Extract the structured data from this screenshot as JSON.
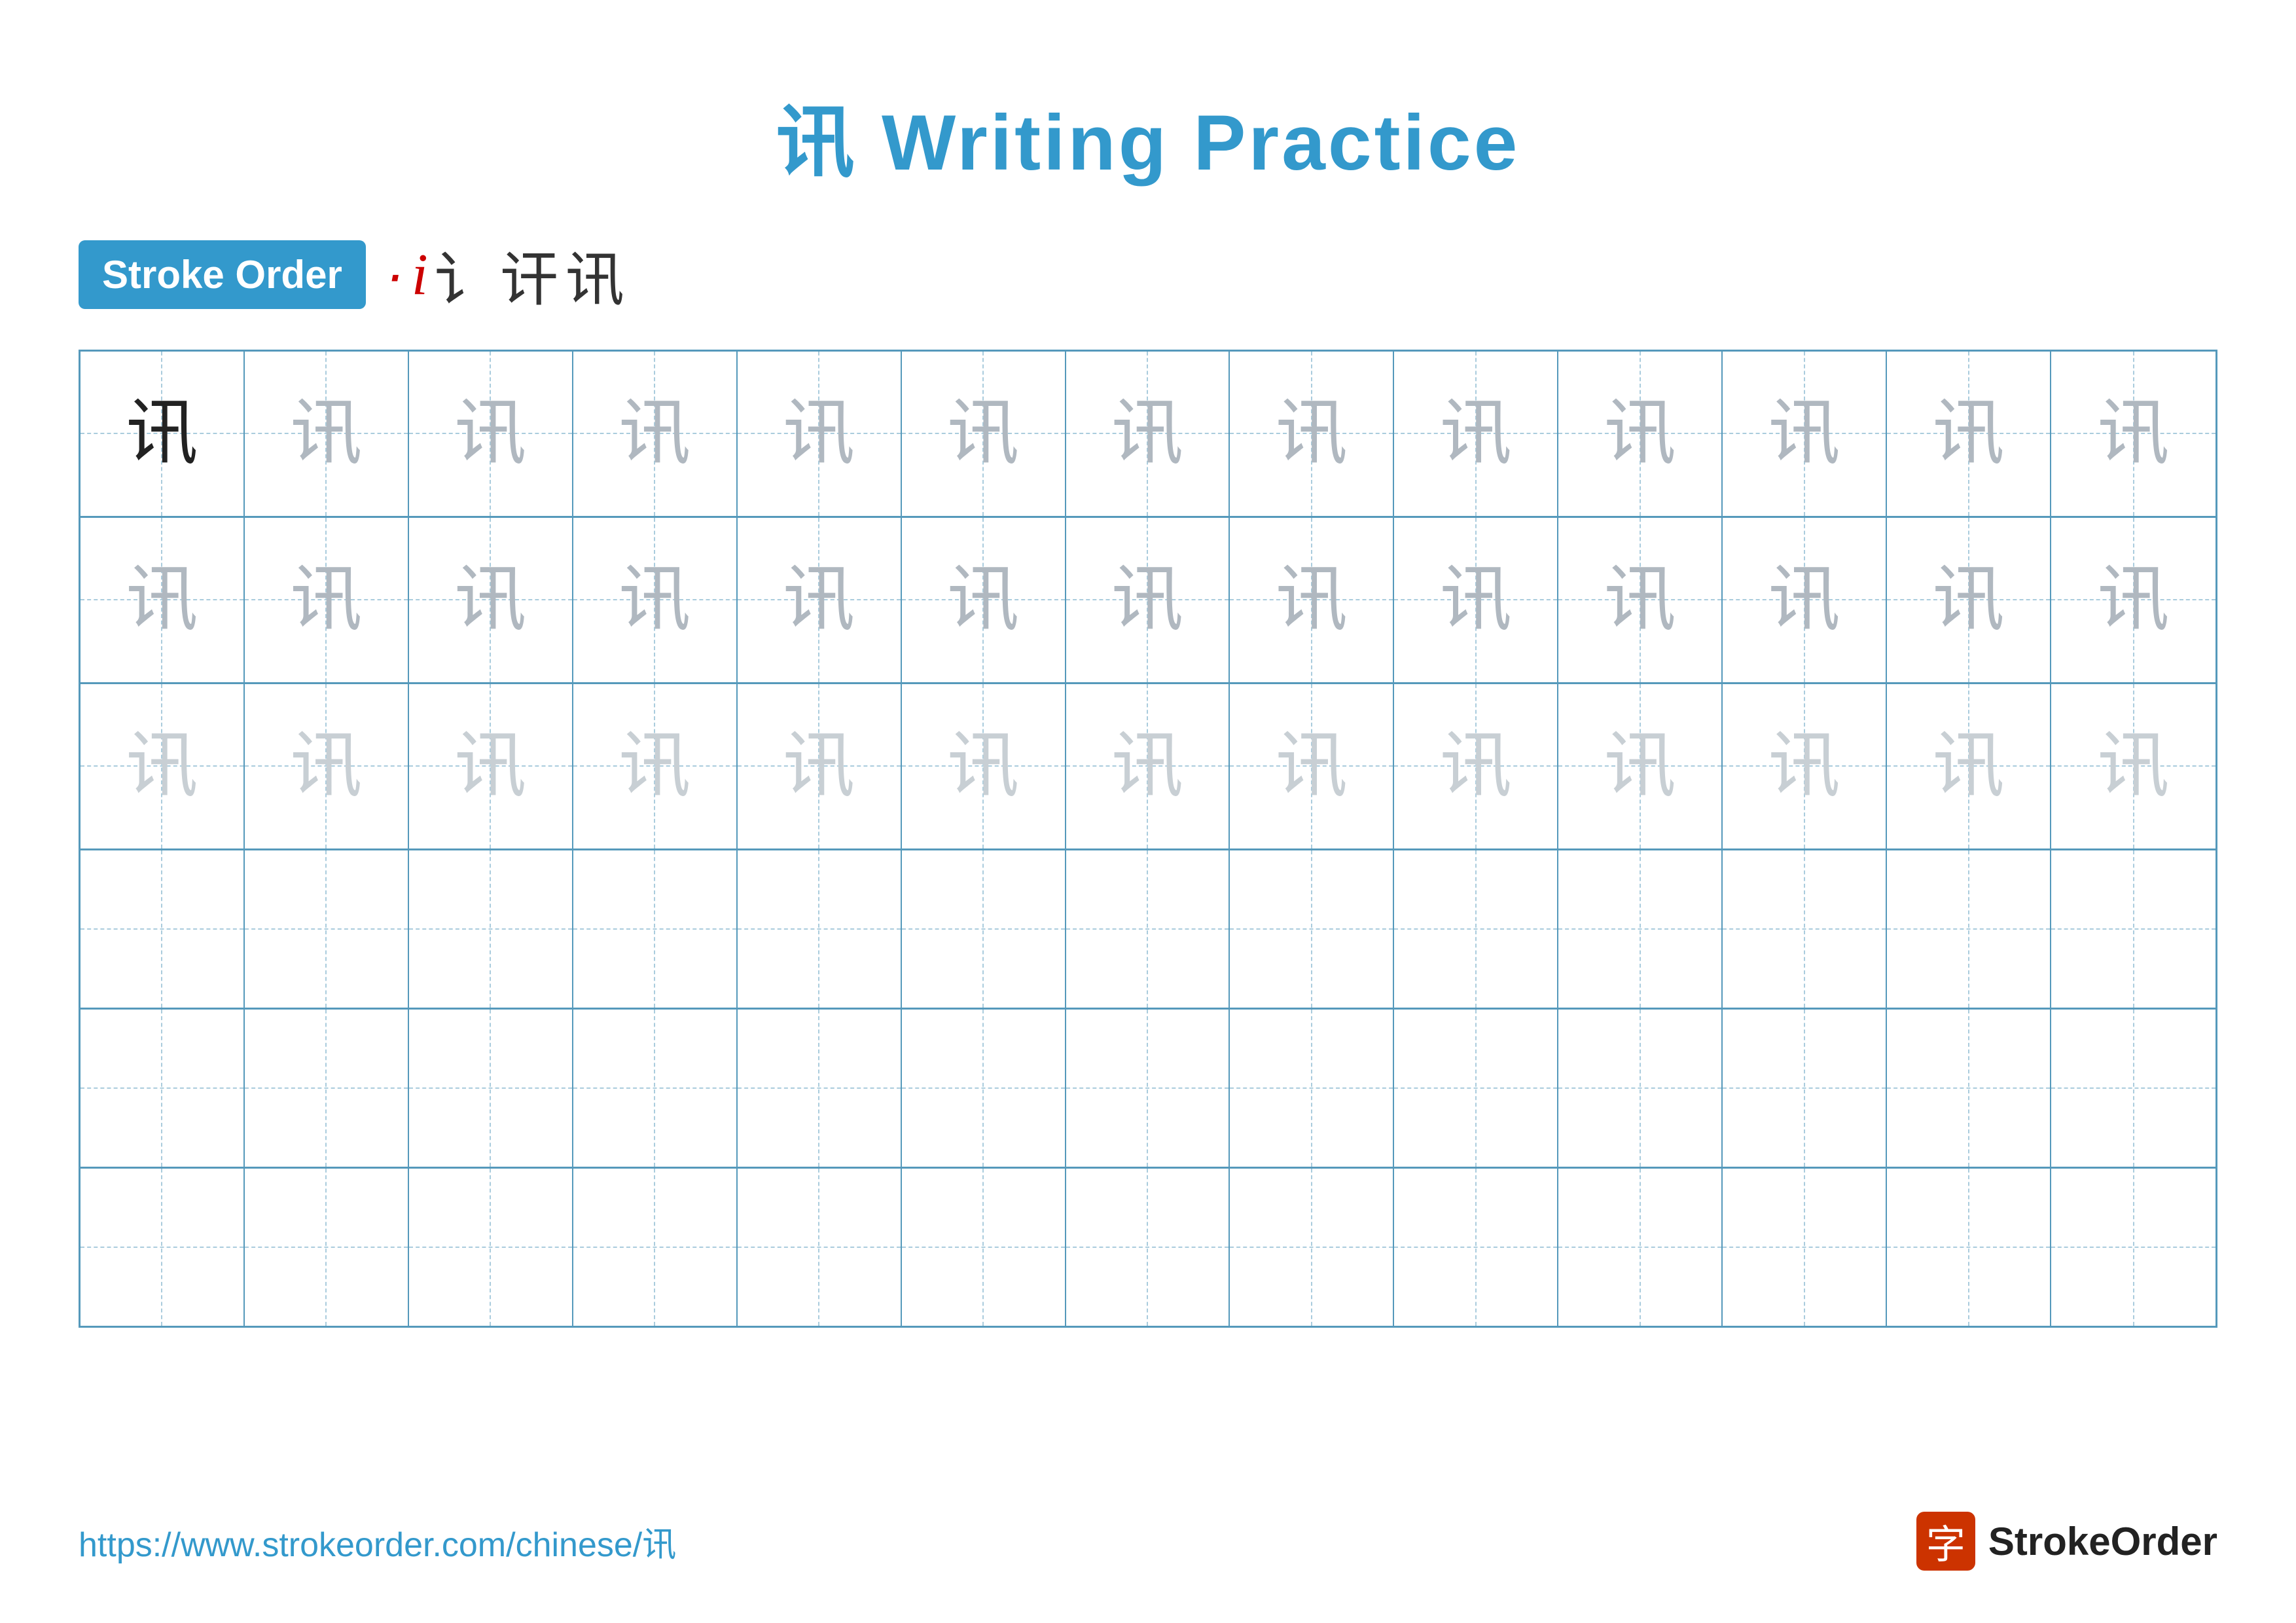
{
  "page": {
    "title": "讯 Writing Practice",
    "character": "讯",
    "url": "https://www.strokeorder.com/chinese/讯",
    "stroke_order_label": "Stroke Order",
    "stroke_sequence": [
      "·",
      "i",
      "讠",
      "讦",
      "讯"
    ],
    "logo_text": "StrokeOrder",
    "logo_icon": "字",
    "grid": {
      "cols": 13,
      "rows": 6,
      "row_types": [
        "dark_then_light",
        "light",
        "lighter",
        "empty",
        "empty",
        "empty"
      ]
    }
  }
}
